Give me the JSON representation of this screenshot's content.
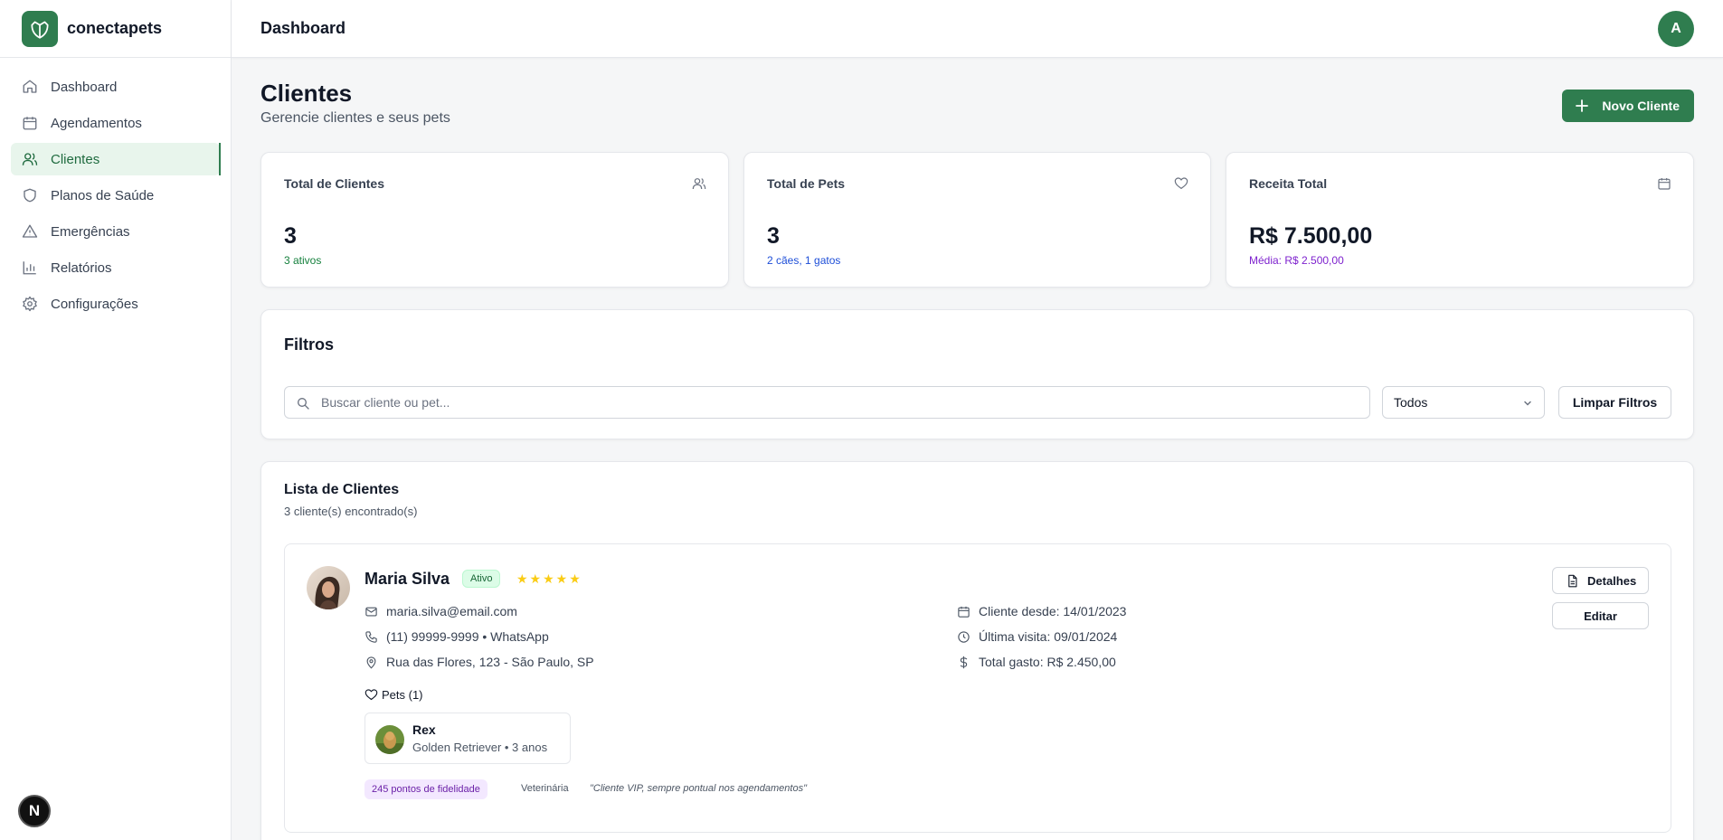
{
  "app": {
    "name": "conectapets"
  },
  "sidebar": {
    "items": [
      {
        "label": "Dashboard",
        "icon": "home-icon"
      },
      {
        "label": "Agendamentos",
        "icon": "calendar-icon"
      },
      {
        "label": "Clientes",
        "icon": "users-icon",
        "active": true
      },
      {
        "label": "Planos de Saúde",
        "icon": "shield-icon"
      },
      {
        "label": "Emergências",
        "icon": "alert-triangle-icon"
      },
      {
        "label": "Relatórios",
        "icon": "bar-chart-icon"
      },
      {
        "label": "Configurações",
        "icon": "gear-icon"
      }
    ],
    "badge": "N"
  },
  "header": {
    "title": "Dashboard",
    "avatar": "A"
  },
  "page": {
    "title": "Clientes",
    "subtitle": "Gerencie clientes e seus pets",
    "new_button": "Novo Cliente"
  },
  "stats": [
    {
      "label": "Total de Clientes",
      "value": "3",
      "sub": "3 ativos",
      "icon": "users-icon",
      "sub_color": "#15803d"
    },
    {
      "label": "Total de Pets",
      "value": "3",
      "sub": "2 cães, 1 gatos",
      "icon": "heart-icon",
      "sub_color": "#1d4ed8"
    },
    {
      "label": "Receita Total",
      "value": "R$ 7.500,00",
      "sub": "Média: R$ 2.500,00",
      "icon": "calendar-icon",
      "sub_color": "#7e22ce"
    }
  ],
  "filters": {
    "title": "Filtros",
    "search_placeholder": "Buscar cliente ou pet...",
    "search_value": "",
    "select_value": "Todos",
    "clear_label": "Limpar Filtros"
  },
  "list": {
    "title": "Lista de Clientes",
    "count_text": "3 cliente(s) encontrado(s)",
    "clients": [
      {
        "name": "Maria Silva",
        "status": "Ativo",
        "rating": 5,
        "stars": "★★★★★",
        "email": "maria.silva@email.com",
        "phone": "(11) 99999-9999 • WhatsApp",
        "address": "Rua das Flores, 123 - São Paulo, SP",
        "since": "Cliente desde: 14/01/2023",
        "last_visit": "Última visita: 09/01/2024",
        "total_spent": "Total gasto: R$ 2.450,00",
        "pets_label": "Pets (1)",
        "pets": [
          {
            "name": "Rex",
            "meta": "Golden Retriever • 3 anos"
          }
        ],
        "loyalty": "245 pontos de fidelidade",
        "service": "Veterinária",
        "note": "\"Cliente VIP, sempre pontual nos agendamentos\"",
        "details_label": "Detalhes",
        "edit_label": "Editar"
      }
    ]
  },
  "colors": {
    "brand": "#2f7d4f",
    "active_bg": "#e8f5ec",
    "star": "#facc15"
  }
}
